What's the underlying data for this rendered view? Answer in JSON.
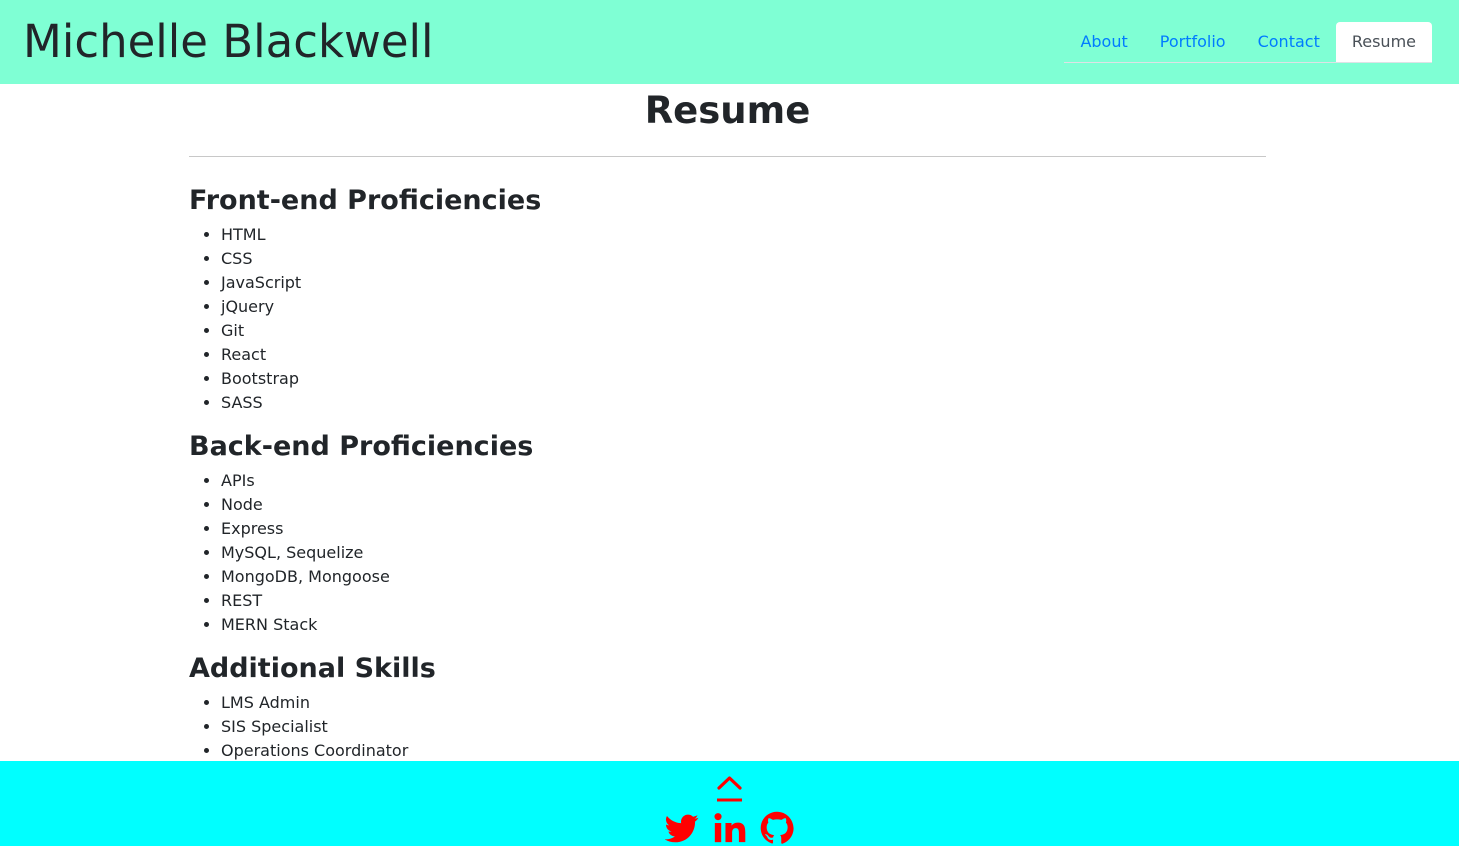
{
  "header": {
    "brand": "Michelle Blackwell",
    "nav": [
      {
        "label": "About"
      },
      {
        "label": "Portfolio"
      },
      {
        "label": "Contact"
      },
      {
        "label": "Resume"
      }
    ]
  },
  "main": {
    "title": "Resume",
    "sections": [
      {
        "title": "Front-end Proficiencies",
        "items": [
          "HTML",
          "CSS",
          "JavaScript",
          "jQuery",
          "Git",
          "React",
          "Bootstrap",
          "SASS"
        ]
      },
      {
        "title": "Back-end Proficiencies",
        "items": [
          "APIs",
          "Node",
          "Express",
          "MySQL, Sequelize",
          "MongoDB, Mongoose",
          "REST",
          "MERN Stack"
        ]
      },
      {
        "title": "Additional Skills",
        "items": [
          "LMS Admin",
          "SIS Specialist",
          "Operations Coordinator"
        ]
      }
    ]
  },
  "footer": {
    "icons": [
      "chevron-up-icon",
      "twitter-icon",
      "linkedin-icon",
      "github-icon"
    ],
    "icon_color": "#ff0000",
    "background": "#00ffff"
  },
  "colors": {
    "header_bg": "#7fffd4",
    "link": "#007bff",
    "text": "#212529"
  }
}
